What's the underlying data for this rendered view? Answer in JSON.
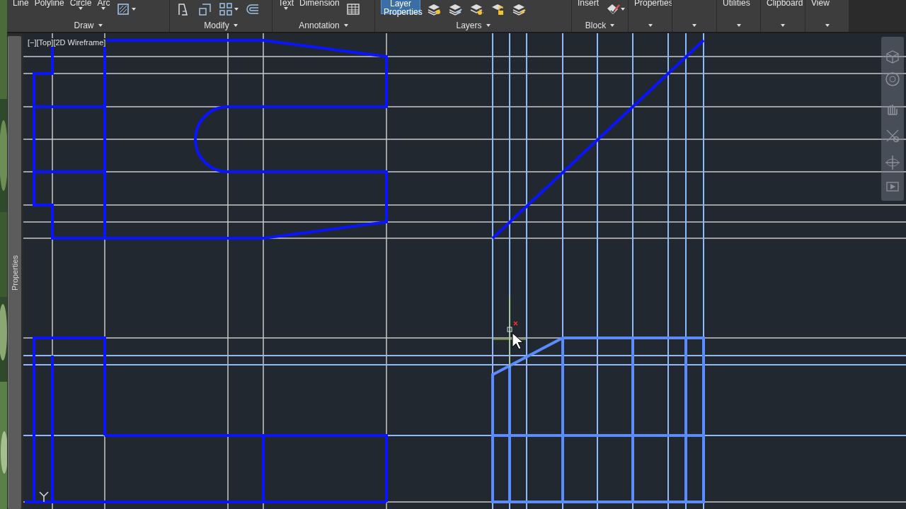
{
  "ribbon": {
    "panels": [
      {
        "title": "Draw",
        "menu": true,
        "tools": [
          {
            "kind": "label",
            "label": "Line",
            "menu": false
          },
          {
            "kind": "label",
            "label": "Polyline",
            "menu": false
          },
          {
            "kind": "label",
            "label": "Circle",
            "menu": true
          },
          {
            "kind": "label",
            "label": "Arc",
            "menu": true
          },
          {
            "kind": "icon",
            "menu": true
          }
        ]
      },
      {
        "title": "Modify",
        "menu": true,
        "tools": [
          {
            "kind": "icon",
            "menu": false
          },
          {
            "kind": "icon",
            "menu": false
          },
          {
            "kind": "icon",
            "menu": true
          },
          {
            "kind": "icon",
            "menu": false
          }
        ]
      },
      {
        "title": "Annotation",
        "menu": true,
        "tools": [
          {
            "kind": "label",
            "label": "Text",
            "menu": true
          },
          {
            "kind": "label",
            "label": "Dimension",
            "menu": false
          },
          {
            "kind": "icon",
            "menu": false
          }
        ]
      },
      {
        "title": "Layers",
        "menu": true,
        "tools": [
          {
            "kind": "large",
            "label": "Layer Properties",
            "menu": false
          },
          {
            "kind": "icon",
            "menu": false
          },
          {
            "kind": "icon",
            "menu": false
          },
          {
            "kind": "icon",
            "menu": false
          },
          {
            "kind": "icon",
            "menu": false
          },
          {
            "kind": "icon",
            "menu": false
          }
        ]
      },
      {
        "title": "Block",
        "menu": true,
        "tools": [
          {
            "kind": "label",
            "label": "Insert",
            "menu": false
          },
          {
            "kind": "icon",
            "menu": true
          }
        ]
      },
      {
        "menu": true,
        "tools": [
          {
            "kind": "label",
            "label": "Properties",
            "menu": false
          }
        ]
      },
      {
        "menu": true
      },
      {
        "menu": true,
        "tools": [
          {
            "kind": "label",
            "label": "Utilities",
            "menu": false
          }
        ]
      },
      {
        "menu": true,
        "tools": [
          {
            "kind": "label",
            "label": "Clipboard",
            "menu": false
          }
        ]
      },
      {
        "menu": true,
        "tools": [
          {
            "kind": "label",
            "label": "View",
            "menu": false
          }
        ]
      }
    ]
  },
  "palette": {
    "title": "Properties"
  },
  "viewport": {
    "label": "[−][Top][2D Wireframe]"
  }
}
